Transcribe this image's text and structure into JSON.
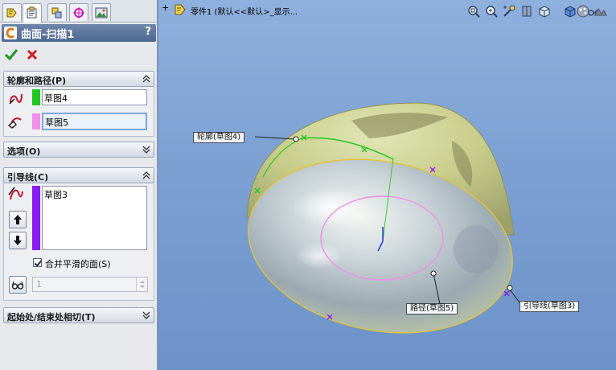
{
  "feature": {
    "title": "曲面-扫描1",
    "help": "?"
  },
  "sections": {
    "profile_path": {
      "title": "轮廓和路径(P)",
      "profile_value": "草图4",
      "path_value": "草图5"
    },
    "options": {
      "title": "选项(O)"
    },
    "guide": {
      "title": "引导线(C)",
      "guide_value": "草图3",
      "merge_label": "合并平滑的面(S)",
      "merge_checked": true,
      "count_value": "1"
    },
    "tangency": {
      "title": "起始处/结束处相切(T)"
    }
  },
  "viewport": {
    "expander": "+",
    "crumb": "零件1 (默认<<默认>_显示...",
    "callouts": {
      "profile": "轮廓(草图4)",
      "path": "路径(草图5)",
      "guide": "引导线(草图3)"
    }
  },
  "colors": {
    "profile_swatch": "#22c622",
    "path_swatch": "#f08ee8",
    "guide_swatch": "#8a1cf0",
    "header": "#5a72a0",
    "viewport_bg": "#7ca0d2"
  },
  "icons": [
    "feature-manager-tab-icon",
    "property-manager-tab-icon",
    "configuration-manager-tab-icon",
    "dimxpert-tab-icon",
    "display-manager-tab-icon",
    "ok-check-icon",
    "cancel-x-icon",
    "zoom-to-fit-icon",
    "zoom-area-icon",
    "previous-view-icon",
    "section-view-icon",
    "view-orientation-icon",
    "display-style-icon",
    "hide-show-icon",
    "appearance-icon",
    "scene-icon"
  ]
}
